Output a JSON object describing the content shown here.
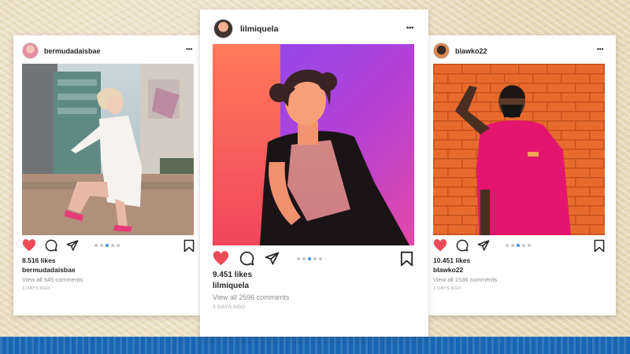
{
  "posts": [
    {
      "username": "bermudadaisbae",
      "likes": "8.516 likes",
      "caption_user": "bermudadaisbae",
      "comments": "View all 545 comments",
      "time_ago": "3 DAYS AGO",
      "carousel_dots": 5,
      "carousel_active": 2
    },
    {
      "username": "lilmiquela",
      "likes": "9.451 likes",
      "caption_user": "lilmiquela",
      "comments": "View all 2596 comments",
      "time_ago": "3 DAYS AGO",
      "carousel_dots": 5,
      "carousel_active": 2
    },
    {
      "username": "blawko22",
      "likes": "10.451 likes",
      "caption_user": "blawko22",
      "comments": "View all 1536 comments",
      "time_ago": "3 DAYS AGO",
      "carousel_dots": 5,
      "carousel_active": 2
    }
  ],
  "more_options_glyph": "•••",
  "icons": [
    "heart-icon",
    "comment-icon",
    "share-icon",
    "bookmark-icon",
    "more-options-icon"
  ],
  "colors": {
    "liked_heart": "#ed4956",
    "carousel_active": "#3897f0",
    "bottom_band": "#1766b3",
    "background": "#ece0c8"
  }
}
